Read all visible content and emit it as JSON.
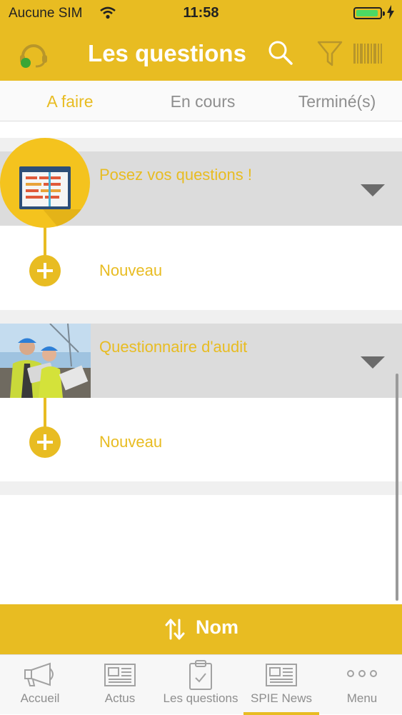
{
  "status_bar": {
    "carrier": "Aucune SIM",
    "time": "11:58"
  },
  "header": {
    "title": "Les questions"
  },
  "tabs": [
    {
      "label": "A faire",
      "active": true
    },
    {
      "label": "En cours",
      "active": false
    },
    {
      "label": "Terminé(s)",
      "active": false
    }
  ],
  "groups": [
    {
      "title": "Posez vos questions !",
      "action_label": "Nouveau"
    },
    {
      "title": "Questionnaire d'audit",
      "action_label": "Nouveau"
    }
  ],
  "sort": {
    "label": "Nom"
  },
  "tabbar": [
    {
      "label": "Accueil",
      "icon": "megaphone-icon"
    },
    {
      "label": "Actus",
      "icon": "newspaper-icon"
    },
    {
      "label": "Les questions",
      "icon": "clipboard-check-icon"
    },
    {
      "label": "SPIE News",
      "icon": "newspaper-icon",
      "selected": true
    },
    {
      "label": "Menu",
      "icon": "more-dots-icon"
    }
  ],
  "colors": {
    "accent": "#E8BC22",
    "header_bg": "#E8BC22",
    "group_header_bg": "#dcdcdc",
    "inactive_text": "#8e8e8e"
  }
}
